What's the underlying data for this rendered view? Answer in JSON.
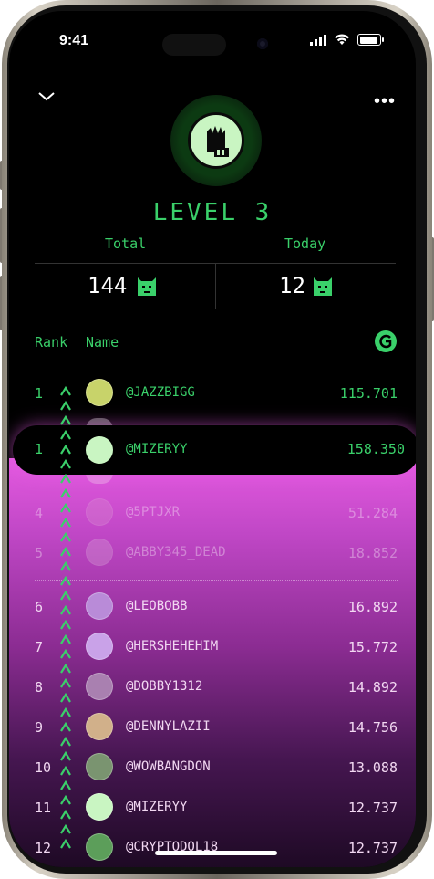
{
  "status_bar": {
    "time": "9:41"
  },
  "header": {
    "more_label": "•••"
  },
  "level_label": "LEVEL 3",
  "stats": {
    "total_label": "Total",
    "today_label": "Today",
    "total_value": "144",
    "today_value": "12"
  },
  "table": {
    "rank_header": "Rank",
    "name_header": "Name"
  },
  "current_user": {
    "rank": "1",
    "name": "@MIZERYY",
    "score": "158.350"
  },
  "rows": [
    {
      "rank": "1",
      "name": "@JAZZBIGG",
      "score": "115.701",
      "avatar_color": "#c8d36a"
    },
    {
      "rank": "4",
      "name": "@5PTJXR",
      "score": "51.284",
      "avatar_color": "#d98bd0"
    },
    {
      "rank": "5",
      "name": "@ABBY345_DEAD",
      "score": "18.852",
      "avatar_color": "#d7a0d6"
    },
    {
      "rank": "6",
      "name": "@LEOBOBB",
      "score": "16.892",
      "avatar_color": "#b98bd8"
    },
    {
      "rank": "7",
      "name": "@HERSHEHEHIM",
      "score": "15.772",
      "avatar_color": "#c9a2e8"
    },
    {
      "rank": "8",
      "name": "@DOBBY1312",
      "score": "14.892",
      "avatar_color": "#a980b0"
    },
    {
      "rank": "9",
      "name": "@DENNYLAZII",
      "score": "14.756",
      "avatar_color": "#d1b08a"
    },
    {
      "rank": "10",
      "name": "@WOWBANGDON",
      "score": "13.088",
      "avatar_color": "#7a9470"
    },
    {
      "rank": "11",
      "name": "@MIZERYY",
      "score": "12.737",
      "avatar_color": "#c9f5c2"
    },
    {
      "rank": "12",
      "name": "@CRYPTODOL18",
      "score": "12.737",
      "avatar_color": "#5c9e5a"
    }
  ],
  "colors": {
    "accent_green": "#3ad06a",
    "pink": "#e45ae0"
  }
}
